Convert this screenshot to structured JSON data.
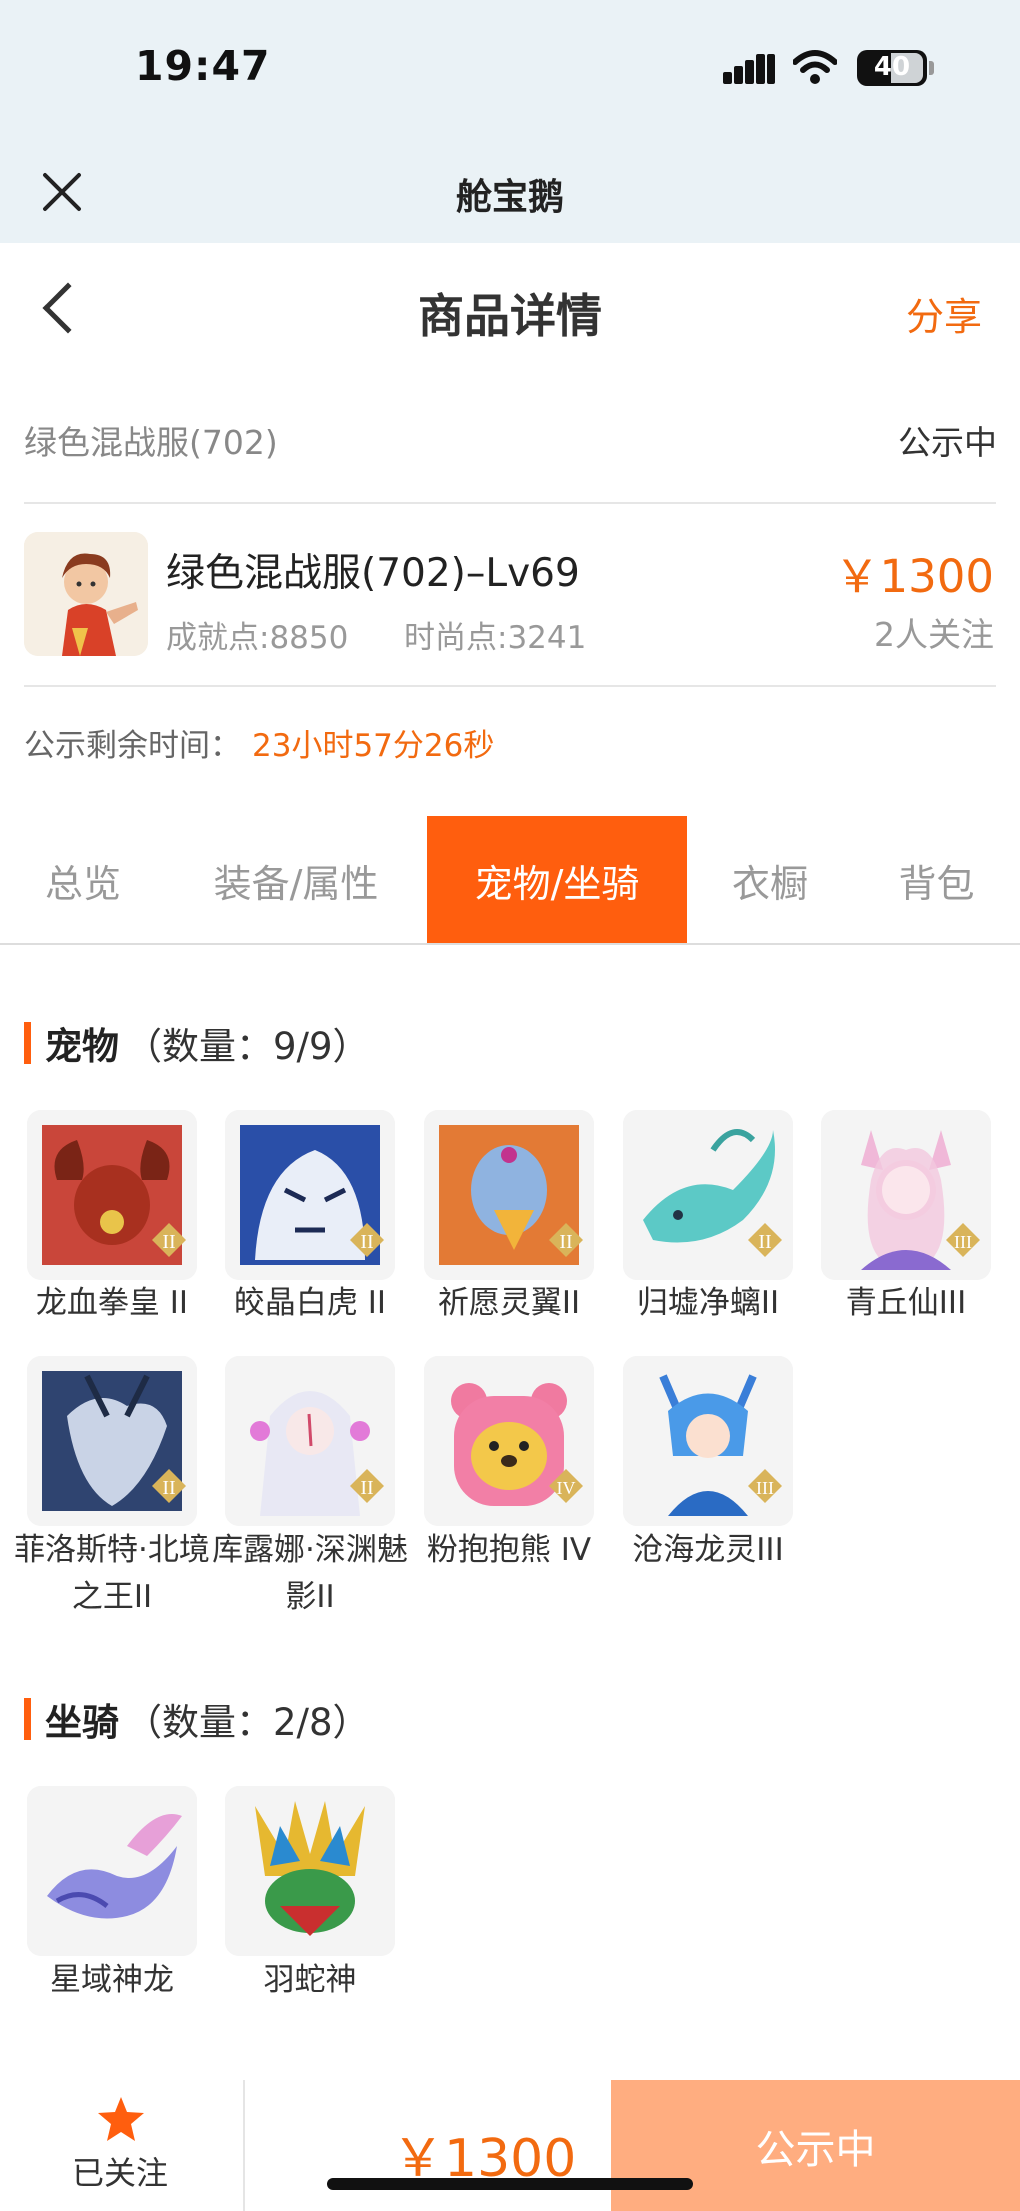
{
  "status_bar": {
    "time": "19:47",
    "battery": "40"
  },
  "app_header": {
    "title": "舱宝鹅"
  },
  "nav": {
    "title": "商品详情",
    "share_label": "分享"
  },
  "listing": {
    "server": "绿色混战服(702)",
    "status": "公示中",
    "title": "绿色混战服(702)–Lv69",
    "achievement": "成就点:8850",
    "fashion": "时尚点:3241",
    "price": "￥1300",
    "followers": "2人关注",
    "remaining_label": "公示剩余时间：",
    "remaining_value": "23小时57分26秒"
  },
  "tabs": [
    {
      "label": "总览",
      "active": false
    },
    {
      "label": "装备/属性",
      "active": false
    },
    {
      "label": "宠物/坐骑",
      "active": true
    },
    {
      "label": "衣橱",
      "active": false
    },
    {
      "label": "背包",
      "active": false
    }
  ],
  "pets": {
    "title": "宠物",
    "count": "（数量：9/9）",
    "items": [
      {
        "name": "龙血拳皇 II",
        "icon": "red-beast-icon",
        "badge": "II"
      },
      {
        "name": "皎晶白虎 II",
        "icon": "white-tiger-icon",
        "badge": "II"
      },
      {
        "name": "祈愿灵翼II",
        "icon": "eagle-icon",
        "badge": "II"
      },
      {
        "name": "归墟净螭II",
        "icon": "cyan-dragon-icon",
        "badge": "II"
      },
      {
        "name": "青丘仙III",
        "icon": "fox-fairy-icon",
        "badge": "III"
      },
      {
        "name": "菲洛斯特·北境之王II",
        "icon": "dark-dragon-knight-icon",
        "badge": "II"
      },
      {
        "name": "库露娜·深渊魅影II",
        "icon": "white-hair-girl-icon",
        "badge": "II"
      },
      {
        "name": "粉抱抱熊 IV",
        "icon": "pink-bear-icon",
        "badge": "IV"
      },
      {
        "name": "沧海龙灵III",
        "icon": "blue-dragon-boy-icon",
        "badge": "III"
      }
    ]
  },
  "mounts": {
    "title": "坐骑",
    "count": "（数量：2/8）",
    "items": [
      {
        "name": "星域神龙",
        "icon": "star-dragon-icon"
      },
      {
        "name": "羽蛇神",
        "icon": "feathered-serpent-icon"
      }
    ]
  },
  "bottom_bar": {
    "follow_label": "已关注",
    "price": "￥1300",
    "status_label": "公示中"
  },
  "colors": {
    "accent": "#ff5e0e",
    "price": "#f26a10",
    "status_button": "#ffad80"
  }
}
